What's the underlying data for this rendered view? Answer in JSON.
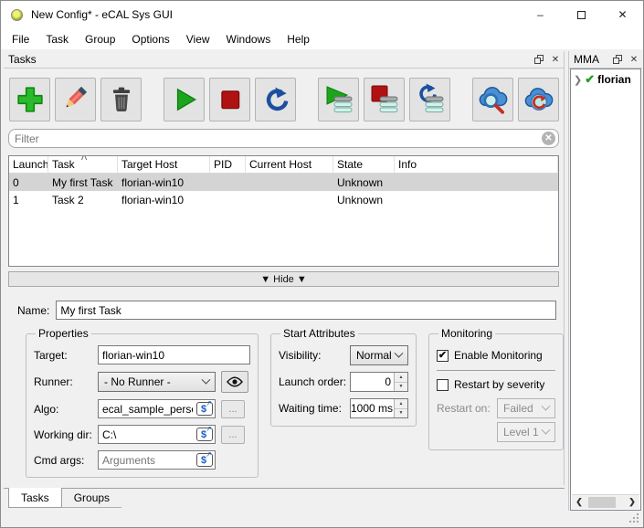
{
  "window": {
    "title": "New Config* - eCAL Sys GUI",
    "controls": {
      "minimize": "–",
      "close": "✕"
    }
  },
  "menu": {
    "items": [
      "File",
      "Task",
      "Group",
      "Options",
      "View",
      "Windows",
      "Help"
    ]
  },
  "icons": {
    "clear": "✕",
    "sort_asc": "ᐱ",
    "spin_up": "▲",
    "spin_down": "▼",
    "dollar": "$",
    "expand_arrow": "↗",
    "browse": "...",
    "tree_expander": "❯",
    "tree_check": "✔",
    "scroll_left": "❮",
    "scroll_right": "❯",
    "toolbar_icon_names": [
      "add-icon",
      "edit-pencil-icon",
      "delete-trash-icon",
      "start-icon",
      "stop-icon",
      "restart-icon",
      "start-selected-icon",
      "stop-selected-icon",
      "restart-selected-icon",
      "cloud-search-icon",
      "cloud-refresh-icon"
    ]
  },
  "colors": {
    "accent_green": "#1ca51c",
    "accent_red": "#b01212",
    "accent_blue": "#1d4fa0",
    "cloud_blue": "#4a8fd4",
    "selection_gray": "#d4d4d4",
    "check_green": "#21a121"
  },
  "tasks_panel": {
    "title": "Tasks",
    "filter": {
      "placeholder": "Filter"
    },
    "table": {
      "columns": [
        "Launch",
        "Task",
        "Target Host",
        "PID",
        "Current Host",
        "State",
        "Info"
      ],
      "sort_column": "Task",
      "rows": [
        {
          "launch": "0",
          "task": "My first Task",
          "target_host": "florian-win10",
          "pid": "",
          "current_host": "",
          "state": "Unknown",
          "info": "",
          "selected": true
        },
        {
          "launch": "1",
          "task": "Task 2",
          "target_host": "florian-win10",
          "pid": "",
          "current_host": "",
          "state": "Unknown",
          "info": "",
          "selected": false
        }
      ]
    },
    "hide_button": "▼ Hide ▼",
    "name_field": {
      "label": "Name:",
      "value": "My first Task"
    },
    "properties": {
      "title": "Properties",
      "target": {
        "label": "Target:",
        "value": "florian-win10"
      },
      "runner": {
        "label": "Runner:",
        "value": "- No Runner -"
      },
      "algo": {
        "label": "Algo:",
        "value": "ecal_sample_person_snd"
      },
      "working_dir": {
        "label": "Working dir:",
        "value": "C:\\"
      },
      "cmd_args": {
        "label": "Cmd args:",
        "placeholder": "Arguments"
      }
    },
    "start_attributes": {
      "title": "Start Attributes",
      "visibility": {
        "label": "Visibility:",
        "value": "Normal"
      },
      "launch_order": {
        "label": "Launch order:",
        "value": "0"
      },
      "waiting_time": {
        "label": "Waiting time:",
        "value": "1000 ms"
      }
    },
    "monitoring": {
      "title": "Monitoring",
      "enable": {
        "label": "Enable Monitoring",
        "checked": true
      },
      "restart_by_severity": {
        "label": "Restart by severity",
        "checked": false
      },
      "restart_on": {
        "label": "Restart on:",
        "value": "Failed"
      },
      "restart_level": {
        "value": "Level 1"
      }
    }
  },
  "bottom_tabs": {
    "tabs": [
      {
        "label": "Tasks",
        "active": true
      },
      {
        "label": "Groups",
        "active": false
      }
    ]
  },
  "mma_panel": {
    "title": "MMA",
    "tree": [
      {
        "label": "florian",
        "status": "ok"
      }
    ]
  }
}
